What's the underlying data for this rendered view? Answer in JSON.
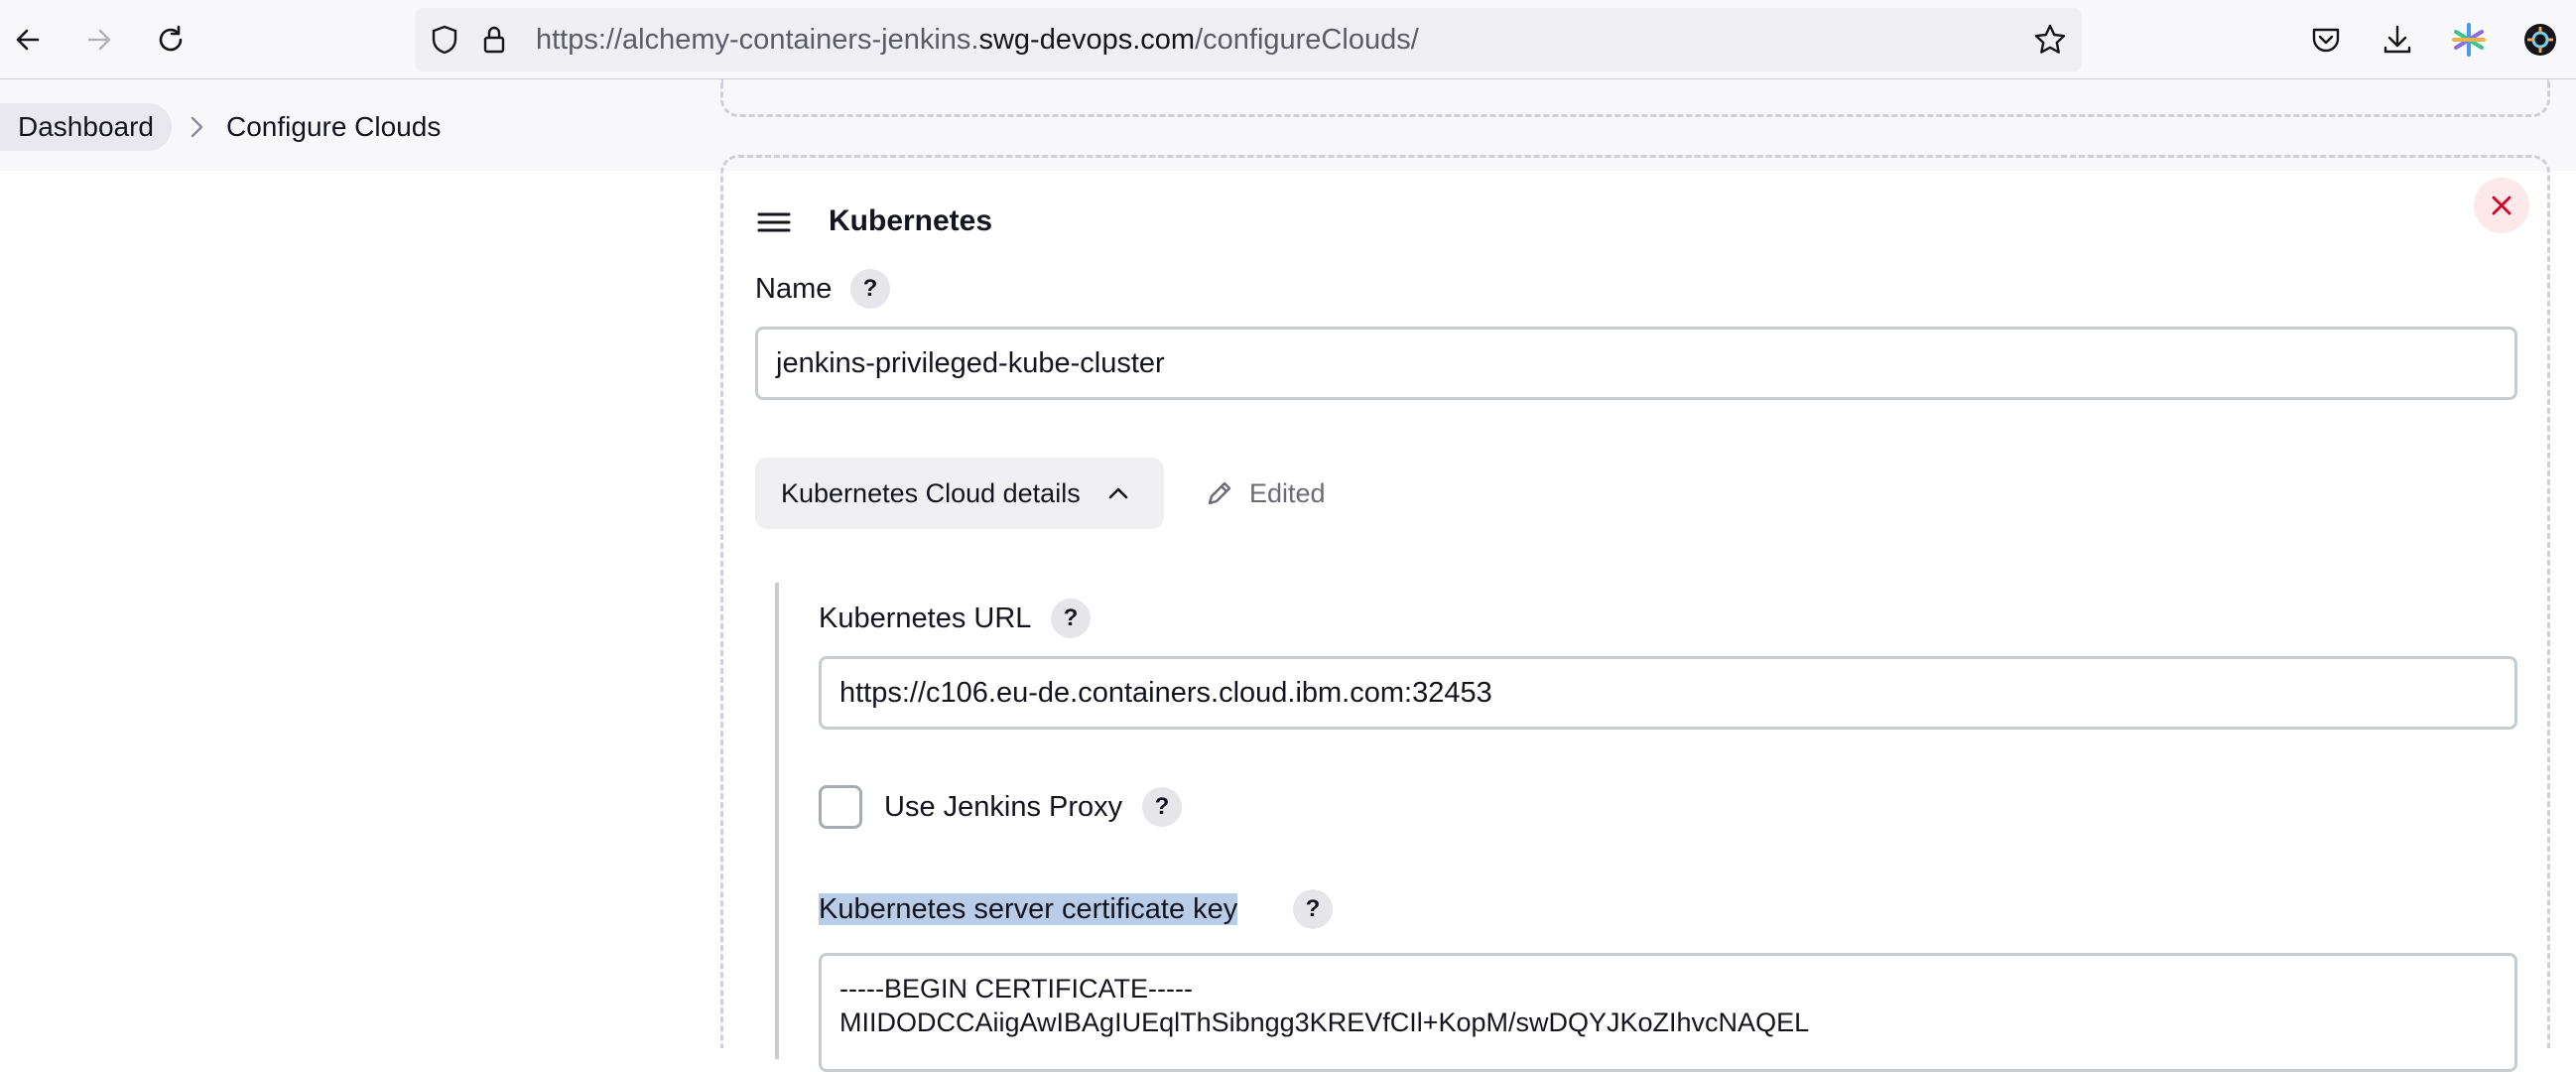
{
  "browser": {
    "url_prefix": "https://alchemy-containers-jenkins.",
    "url_host": "swg-devops.com",
    "url_path": "/configureClouds/"
  },
  "breadcrumb": {
    "items": [
      "Dashboard",
      "Configure Clouds"
    ]
  },
  "cloud": {
    "title": "Kubernetes",
    "name_label": "Name",
    "name_value": "jenkins-privileged-kube-cluster",
    "details_button": "Kubernetes Cloud details",
    "edited_label": "Edited",
    "url_label": "Kubernetes URL",
    "url_value": "https://c106.eu-de.containers.cloud.ibm.com:32453",
    "proxy_label": "Use Jenkins Proxy",
    "proxy_checked": false,
    "cert_label": "Kubernetes server certificate key",
    "cert_lines": [
      "-----BEGIN CERTIFICATE-----",
      "MIIDODCCAiigAwIBAgIUEqlThSibngg3KREVfCIl+KopM/swDQYJKoZIhvcNAQEL"
    ],
    "help_mark": "?"
  },
  "colors": {
    "close_icon": "#d70022",
    "highlight": "#b9cde8"
  }
}
